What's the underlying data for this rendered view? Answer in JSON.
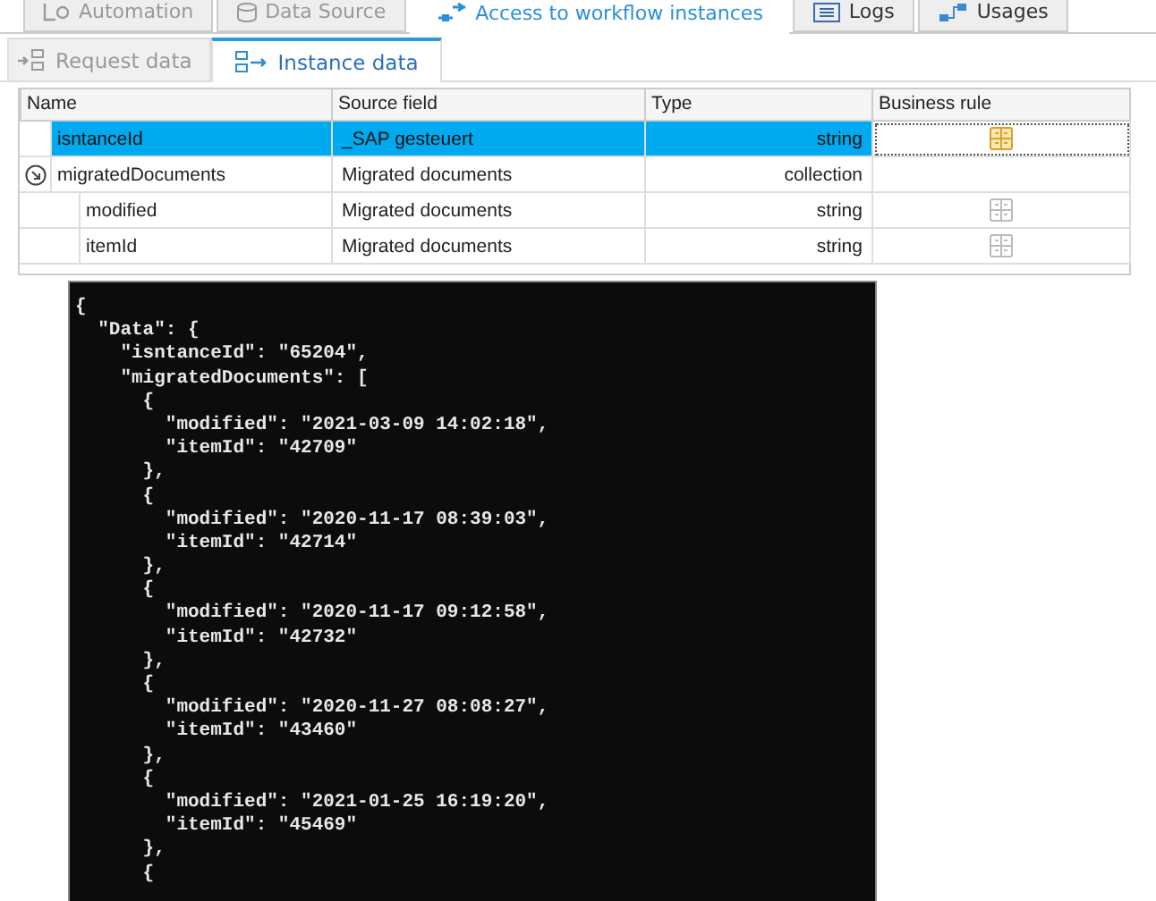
{
  "top_tabs": [
    {
      "label": "Automation",
      "selected": false
    },
    {
      "label": "Data Source",
      "selected": false
    },
    {
      "label": "Access to workflow instances",
      "selected": true
    },
    {
      "label": "Logs",
      "selected": false
    },
    {
      "label": "Usages",
      "selected": false
    }
  ],
  "sub_tabs": [
    {
      "label": "Request data",
      "selected": false
    },
    {
      "label": "Instance data",
      "selected": true
    }
  ],
  "table": {
    "columns": [
      "Name",
      "Source field",
      "Type",
      "Business rule"
    ],
    "rows": [
      {
        "name": "isntanceId",
        "source_field": "_SAP gesteuert",
        "type": "string",
        "business_rule": true,
        "selected": true
      },
      {
        "name": "migratedDocuments",
        "source_field": "Migrated documents",
        "type": "collection",
        "business_rule": false,
        "selected": false,
        "expanded": true,
        "children": [
          {
            "name": "modified",
            "source_field": "Migrated documents",
            "type": "string",
            "business_rule": true,
            "selected": false
          },
          {
            "name": "itemId",
            "source_field": "Migrated documents",
            "type": "string",
            "business_rule": true,
            "selected": false
          }
        ]
      }
    ]
  },
  "console": {
    "lines": [
      "{",
      "  \"Data\": {",
      "    \"isntanceId\": \"65204\",",
      "    \"migratedDocuments\": [",
      "      {",
      "        \"modified\": \"2021-03-09 14:02:18\",",
      "        \"itemId\": \"42709\"",
      "      },",
      "      {",
      "        \"modified\": \"2020-11-17 08:39:03\",",
      "        \"itemId\": \"42714\"",
      "      },",
      "      {",
      "        \"modified\": \"2020-11-17 09:12:58\",",
      "        \"itemId\": \"42732\"",
      "      },",
      "      {",
      "        \"modified\": \"2020-11-27 08:08:27\",",
      "        \"itemId\": \"43460\"",
      "      },",
      "      {",
      "        \"modified\": \"2021-01-25 16:19:20\",",
      "        \"itemId\": \"45469\"",
      "      },",
      "      {"
    ]
  }
}
